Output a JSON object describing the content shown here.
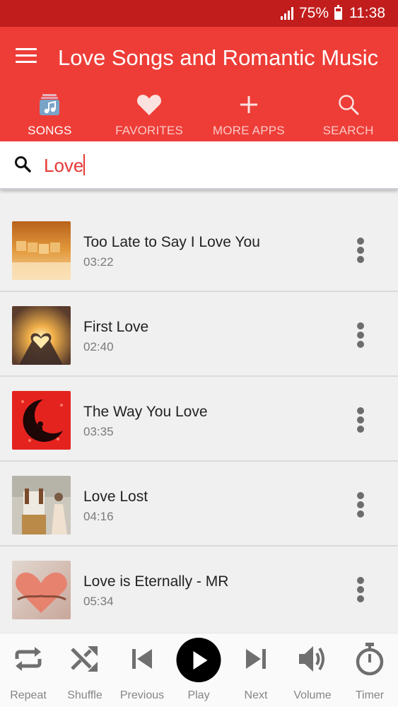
{
  "status_bar": {
    "battery": "75%",
    "battery_level": 0.75,
    "time": "11:38"
  },
  "header": {
    "title": "Love Songs and Romantic Music",
    "color": "#ee3d37"
  },
  "tabs": [
    {
      "label": "SONGS",
      "icon": "music-library-icon",
      "active": true
    },
    {
      "label": "FAVORITES",
      "icon": "heart-icon",
      "active": false
    },
    {
      "label": "MORE APPS",
      "icon": "plus-icon",
      "active": false
    },
    {
      "label": "SEARCH",
      "icon": "search-icon",
      "active": false
    }
  ],
  "search": {
    "value": "Love"
  },
  "songs": [
    {
      "title": "Too Late to Say I Love You",
      "duration": "03:22"
    },
    {
      "title": "First Love",
      "duration": "02:40"
    },
    {
      "title": "The Way You Love",
      "duration": "03:35"
    },
    {
      "title": "Love Lost",
      "duration": "04:16"
    },
    {
      "title": "Love is Eternally - MR",
      "duration": "05:34"
    }
  ],
  "player": {
    "repeat": "Repeat",
    "shuffle": "Shuffle",
    "previous": "Previous",
    "play": "Play",
    "next": "Next",
    "volume": "Volume",
    "timer": "Timer"
  }
}
